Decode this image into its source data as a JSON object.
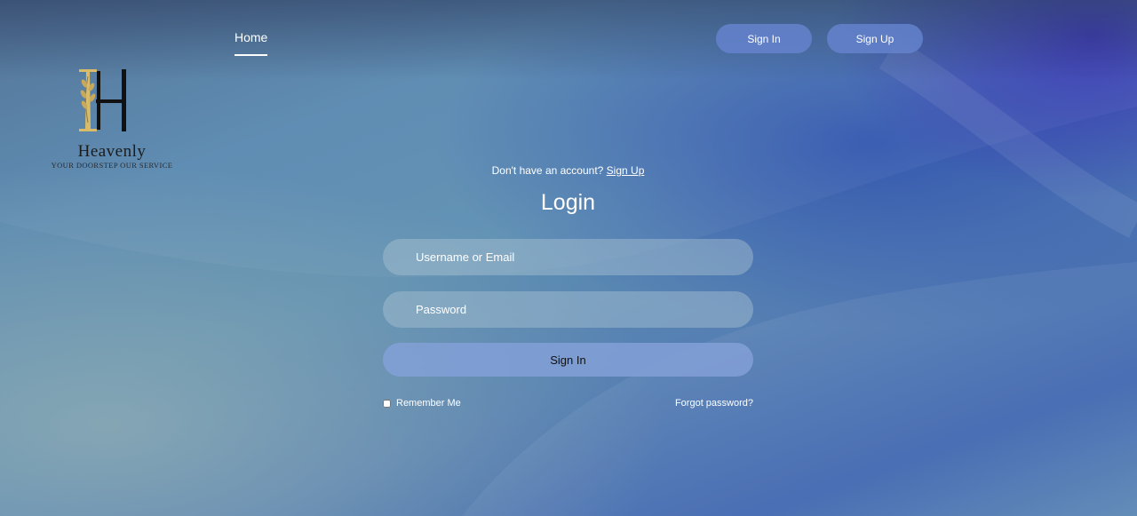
{
  "nav": {
    "home_label": "Home",
    "signin_label": "Sign In",
    "signup_label": "Sign Up"
  },
  "brand": {
    "name": "Heavenly",
    "tagline": "YOUR DOORSTEP OUR SERVICE",
    "logo_icon": "h-wheat-logo-icon"
  },
  "login": {
    "prompt_text": "Don't have an account?",
    "prompt_link": "Sign Up",
    "title": "Login",
    "username_placeholder": "Username or Email",
    "password_placeholder": "Password",
    "submit_label": "Sign In",
    "remember_label": "Remember Me",
    "forgot_label": "Forgot password?"
  },
  "colors": {
    "button_fill": "#6482cd",
    "logo_gold": "#d9bc6a",
    "logo_dark": "#111111"
  }
}
